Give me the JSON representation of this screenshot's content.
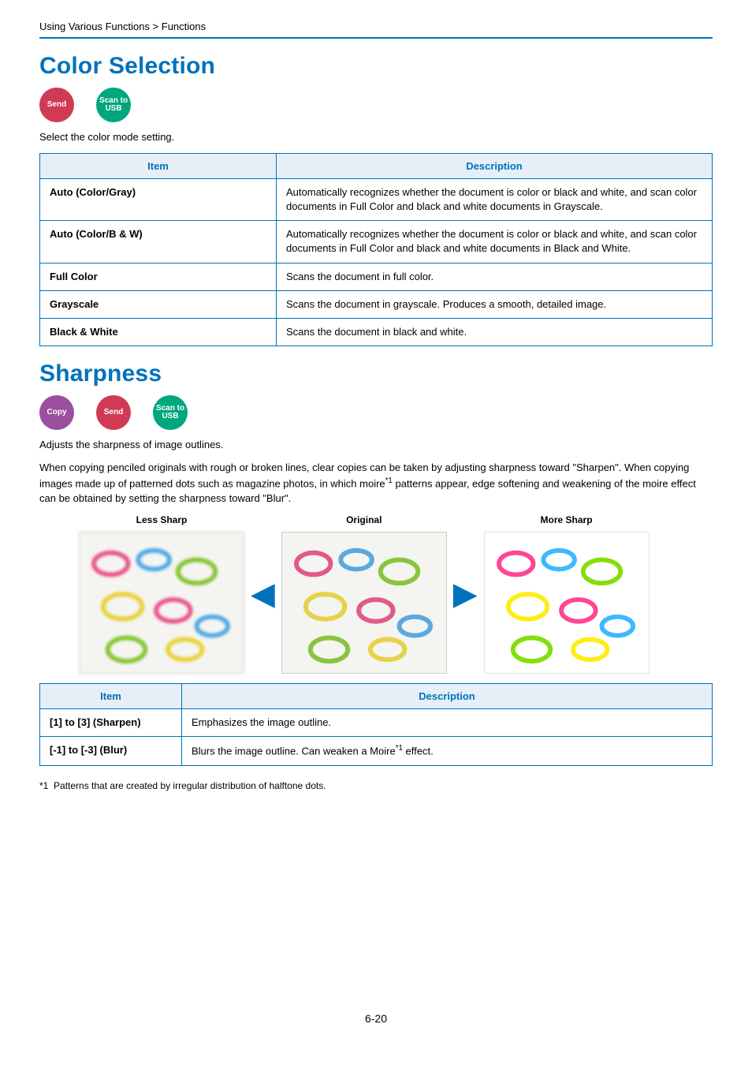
{
  "breadcrumb": "Using Various Functions > Functions",
  "page_number": "6-20",
  "color_selection": {
    "title": "Color Selection",
    "badges": {
      "send": "Send",
      "scan": "Scan to\nUSB"
    },
    "intro": "Select the color mode setting.",
    "table": {
      "header_item": "Item",
      "header_desc": "Description",
      "rows": [
        {
          "item": "Auto (Color/Gray)",
          "desc": "Automatically recognizes whether the document is color or black and white, and scan color documents in Full Color and black and white documents in Grayscale."
        },
        {
          "item": "Auto (Color/B & W)",
          "desc": "Automatically recognizes whether the document is color or black and white, and scan color documents in Full Color and black and white documents in Black and White."
        },
        {
          "item": "Full Color",
          "desc": "Scans the document in full color."
        },
        {
          "item": "Grayscale",
          "desc": "Scans the document in grayscale. Produces a smooth, detailed image."
        },
        {
          "item": "Black & White",
          "desc": "Scans the document in black and white."
        }
      ]
    }
  },
  "sharpness": {
    "title": "Sharpness",
    "badges": {
      "copy": "Copy",
      "send": "Send",
      "scan": "Scan to\nUSB"
    },
    "intro": "Adjusts the sharpness of image outlines.",
    "body_pre_sup": "When copying penciled originals with rough or broken lines, clear copies can be taken by adjusting sharpness toward \"Sharpen\". When copying images made up of patterned dots such as magazine photos, in which moire",
    "body_sup": "*1",
    "body_post_sup": " patterns appear, edge softening and weakening of the moire effect can be obtained by setting the sharpness toward \"Blur\".",
    "samples": {
      "less": "Less Sharp",
      "orig": "Original",
      "more": "More Sharp"
    },
    "table": {
      "header_item": "Item",
      "header_desc": "Description",
      "rows": [
        {
          "item": "[1] to [3] (Sharpen)",
          "desc_pre": "Emphasizes the image outline.",
          "desc_sup": "",
          "desc_post": ""
        },
        {
          "item": "[-1] to [-3] (Blur)",
          "desc_pre": "Blurs the image outline. Can weaken a Moire",
          "desc_sup": "*1",
          "desc_post": " effect."
        }
      ]
    },
    "footnote_label": "*1",
    "footnote_text": "Patterns that are created by irregular distribution of halftone dots."
  }
}
